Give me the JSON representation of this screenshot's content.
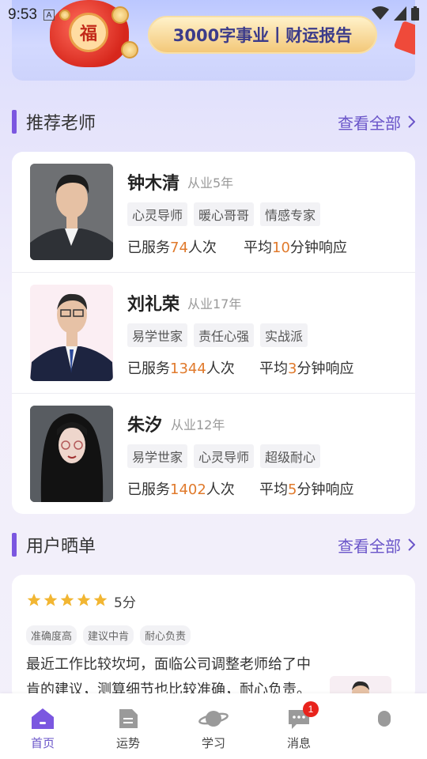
{
  "status_bar": {
    "time": "9:53",
    "indicator": "A"
  },
  "banner": {
    "report_label": "3000字事业丨财运报告",
    "seal_text": "福"
  },
  "recommended": {
    "title": "推荐老师",
    "more": "查看全部",
    "teachers": [
      {
        "name": "钟木清",
        "years": "从业5年",
        "tags": [
          "心灵导师",
          "暖心哥哥",
          "情感专家"
        ],
        "served_prefix": "已服务",
        "served": "74",
        "served_suffix": "人次",
        "resp_prefix": "平均",
        "resp": "10",
        "resp_suffix": "分钟响应"
      },
      {
        "name": "刘礼荣",
        "years": "从业17年",
        "tags": [
          "易学世家",
          "责任心强",
          "实战派"
        ],
        "served_prefix": "已服务",
        "served": "1344",
        "served_suffix": "人次",
        "resp_prefix": "平均",
        "resp": "3",
        "resp_suffix": "分钟响应"
      },
      {
        "name": "朱汐",
        "years": "从业12年",
        "tags": [
          "易学世家",
          "心灵导师",
          "超级耐心"
        ],
        "served_prefix": "已服务",
        "served": "1402",
        "served_suffix": "人次",
        "resp_prefix": "平均",
        "resp": "5",
        "resp_suffix": "分钟响应"
      }
    ]
  },
  "reviews": {
    "title": "用户晒单",
    "more": "查看全部",
    "items": [
      {
        "stars": 5,
        "score": "5分",
        "tags": [
          "准确度高",
          "建议中肯",
          "耐心负责"
        ],
        "text": "最近工作比较坎坷，面临公司调整老师给了中肯的建议，测算细节也比较准确，耐心负责。"
      }
    ]
  },
  "tab_bar": {
    "tabs": [
      {
        "label": "首页",
        "icon": "home-icon",
        "active": true
      },
      {
        "label": "运势",
        "icon": "document-icon"
      },
      {
        "label": "学习",
        "icon": "planet-icon"
      },
      {
        "label": "消息",
        "icon": "chat-icon",
        "badge": "1"
      },
      {
        "label": "",
        "icon": "profile-icon"
      }
    ]
  },
  "colors": {
    "accent": "#6a55c9",
    "highlight": "#e07a2c",
    "badge": "#e8231c",
    "star": "#f2b632"
  }
}
